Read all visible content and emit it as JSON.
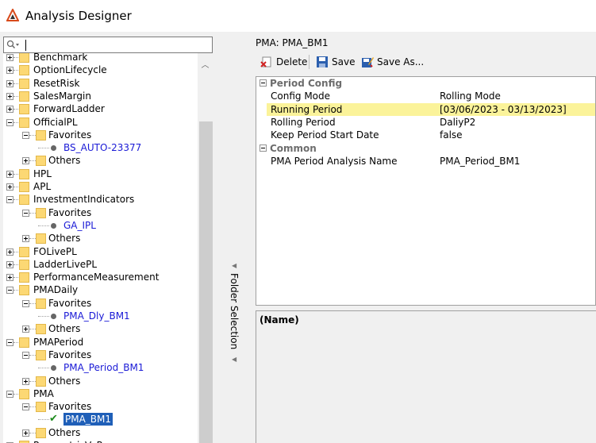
{
  "app": {
    "title": "Analysis Designer"
  },
  "search": {
    "value": ""
  },
  "tree": [
    {
      "label": "Benchmark",
      "type": "folder",
      "expander": "plus"
    },
    {
      "label": "OptionLifecycle",
      "type": "folder",
      "expander": "plus"
    },
    {
      "label": "ResetRisk",
      "type": "folder",
      "expander": "plus"
    },
    {
      "label": "SalesMargin",
      "type": "folder",
      "expander": "plus"
    },
    {
      "label": "ForwardLadder",
      "type": "folder",
      "expander": "plus"
    },
    {
      "label": "OfficialPL",
      "type": "folder",
      "expander": "minus"
    },
    {
      "label": "Favorites",
      "type": "folder",
      "expander": "minus",
      "level": 1
    },
    {
      "label": "BS_AUTO-23377",
      "type": "item",
      "level": 2
    },
    {
      "label": "Others",
      "type": "folder",
      "expander": "plus",
      "level": 1
    },
    {
      "label": "HPL",
      "type": "folder",
      "expander": "plus"
    },
    {
      "label": "APL",
      "type": "folder",
      "expander": "plus"
    },
    {
      "label": "InvestmentIndicators",
      "type": "folder",
      "expander": "minus"
    },
    {
      "label": "Favorites",
      "type": "folder",
      "expander": "minus",
      "level": 1
    },
    {
      "label": "GA_IPL",
      "type": "item",
      "level": 2
    },
    {
      "label": "Others",
      "type": "folder",
      "expander": "plus",
      "level": 1
    },
    {
      "label": "FOLivePL",
      "type": "folder",
      "expander": "plus"
    },
    {
      "label": "LadderLivePL",
      "type": "folder",
      "expander": "plus"
    },
    {
      "label": "PerformanceMeasurement",
      "type": "folder",
      "expander": "plus"
    },
    {
      "label": "PMADaily",
      "type": "folder",
      "expander": "minus"
    },
    {
      "label": "Favorites",
      "type": "folder",
      "expander": "minus",
      "level": 1
    },
    {
      "label": "PMA_Dly_BM1",
      "type": "item",
      "level": 2
    },
    {
      "label": "Others",
      "type": "folder",
      "expander": "plus",
      "level": 1
    },
    {
      "label": "PMAPeriod",
      "type": "folder",
      "expander": "minus"
    },
    {
      "label": "Favorites",
      "type": "folder",
      "expander": "minus",
      "level": 1
    },
    {
      "label": "PMA_Period_BM1",
      "type": "item",
      "level": 2
    },
    {
      "label": "Others",
      "type": "folder",
      "expander": "plus",
      "level": 1
    },
    {
      "label": "PMA",
      "type": "folder",
      "expander": "minus"
    },
    {
      "label": "Favorites",
      "type": "folder",
      "expander": "minus",
      "level": 1
    },
    {
      "label": "PMA_BM1",
      "type": "item",
      "level": 2,
      "selected": true,
      "icon": "checkmark-icon"
    },
    {
      "label": "Others",
      "type": "folder",
      "expander": "plus",
      "level": 1
    },
    {
      "label": "ParametricVaR",
      "type": "folder",
      "expander": "plus"
    }
  ],
  "splitter": {
    "label": "Folder Selection"
  },
  "panel": {
    "title": "PMA: PMA_BM1",
    "toolbar": {
      "delete": "Delete",
      "save": "Save",
      "save_as": "Save As..."
    }
  },
  "properties": {
    "categories": [
      {
        "name": "Period Config",
        "rows": [
          {
            "name": "Config Mode",
            "value": "Rolling Mode"
          },
          {
            "name": "Running Period",
            "value": "[03/06/2023 - 03/13/2023]",
            "highlighted": true
          },
          {
            "name": "Rolling Period",
            "value": "DaliyP2"
          },
          {
            "name": "Keep Period Start Date",
            "value": "false"
          }
        ]
      },
      {
        "name": "Common",
        "rows": [
          {
            "name": "PMA Period Analysis Name",
            "value": "PMA_Period_BM1"
          }
        ]
      }
    ]
  },
  "description": {
    "title": "(Name)"
  },
  "colors": {
    "selection": "#1f5fb8",
    "highlight": "#fbf39a",
    "link": "#1a1ad6",
    "folder": "#fcd874"
  }
}
